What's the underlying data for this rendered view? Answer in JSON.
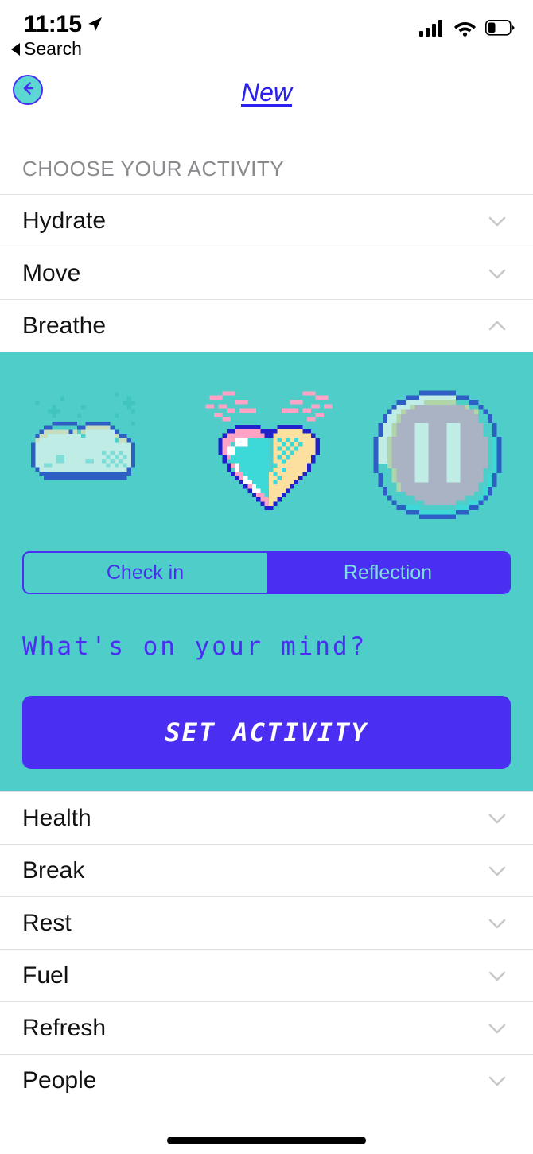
{
  "status_bar": {
    "time": "11:15",
    "back_app_label": "Search",
    "location_icon": "location-arrow-icon",
    "cellular_icon": "cellular-signal-icon",
    "wifi_icon": "wifi-icon",
    "battery_icon": "battery-low-icon"
  },
  "nav": {
    "back_icon": "back-arrow-icon",
    "title": "New"
  },
  "section": {
    "header": "CHOOSE YOUR ACTIVITY"
  },
  "activities": [
    {
      "label": "Hydrate",
      "expanded": false,
      "chevron": "chevron-down-icon"
    },
    {
      "label": "Move",
      "expanded": false,
      "chevron": "chevron-down-icon"
    },
    {
      "label": "Breathe",
      "expanded": true,
      "chevron": "chevron-up-icon"
    },
    {
      "label": "Health",
      "expanded": false,
      "chevron": "chevron-down-icon"
    },
    {
      "label": "Break",
      "expanded": false,
      "chevron": "chevron-down-icon"
    },
    {
      "label": "Rest",
      "expanded": false,
      "chevron": "chevron-down-icon"
    },
    {
      "label": "Fuel",
      "expanded": false,
      "chevron": "chevron-down-icon"
    },
    {
      "label": "Refresh",
      "expanded": false,
      "chevron": "chevron-down-icon"
    },
    {
      "label": "People",
      "expanded": false,
      "chevron": "chevron-down-icon"
    }
  ],
  "breathe_panel": {
    "art": [
      {
        "name": "pixel-cloud-icon"
      },
      {
        "name": "pixel-winged-heart-icon"
      },
      {
        "name": "pixel-pause-button-icon"
      }
    ],
    "segmented": {
      "options": [
        {
          "label": "Check in",
          "selected": false
        },
        {
          "label": "Reflection",
          "selected": true
        }
      ]
    },
    "prompt": "What's on your mind?",
    "cta_label": "SET ACTIVITY"
  },
  "colors": {
    "teal_panel": "#4FCDC9",
    "purple_accent": "#4A2FF2",
    "title_blue": "#2A20F0",
    "seg_on_text": "#7EE0DC",
    "section_header_gray": "#8A8A8E",
    "chevron_gray": "#c8c8c8",
    "row_divider": "#e2e2e2",
    "pixel_outline_blue": "#2222CC",
    "pixel_pink": "#FFA3C4",
    "pixel_cream": "#FCE0A0",
    "pixel_cyan": "#3DD9D9",
    "pixel_mint": "#BFEDE5"
  }
}
